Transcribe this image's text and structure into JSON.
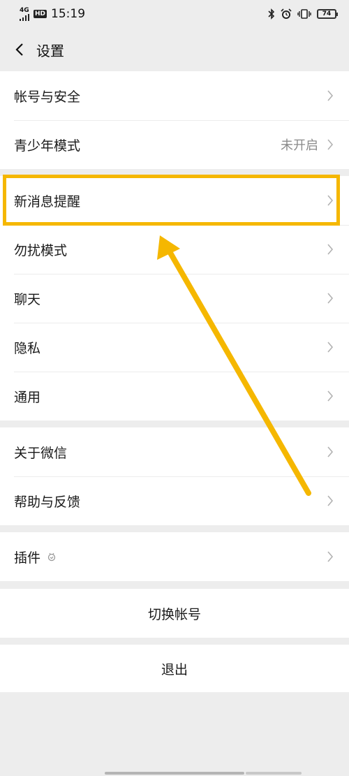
{
  "status_bar": {
    "network": "4G",
    "hd_badge": "HD",
    "time": "15:19",
    "battery": "74"
  },
  "header": {
    "title": "设置"
  },
  "group1": [
    {
      "label": "帐号与安全",
      "value": ""
    },
    {
      "label": "青少年模式",
      "value": "未开启"
    }
  ],
  "group2": [
    {
      "label": "新消息提醒"
    },
    {
      "label": "勿扰模式"
    },
    {
      "label": "聊天"
    },
    {
      "label": "隐私"
    },
    {
      "label": "通用"
    }
  ],
  "group3": [
    {
      "label": "关于微信"
    },
    {
      "label": "帮助与反馈"
    }
  ],
  "group4": [
    {
      "label": "插件"
    }
  ],
  "actions": {
    "switch_account": "切换帐号",
    "logout": "退出"
  },
  "colors": {
    "background": "#ededed",
    "annotation": "#f5b700",
    "secondary_text": "#8a8a8a"
  }
}
